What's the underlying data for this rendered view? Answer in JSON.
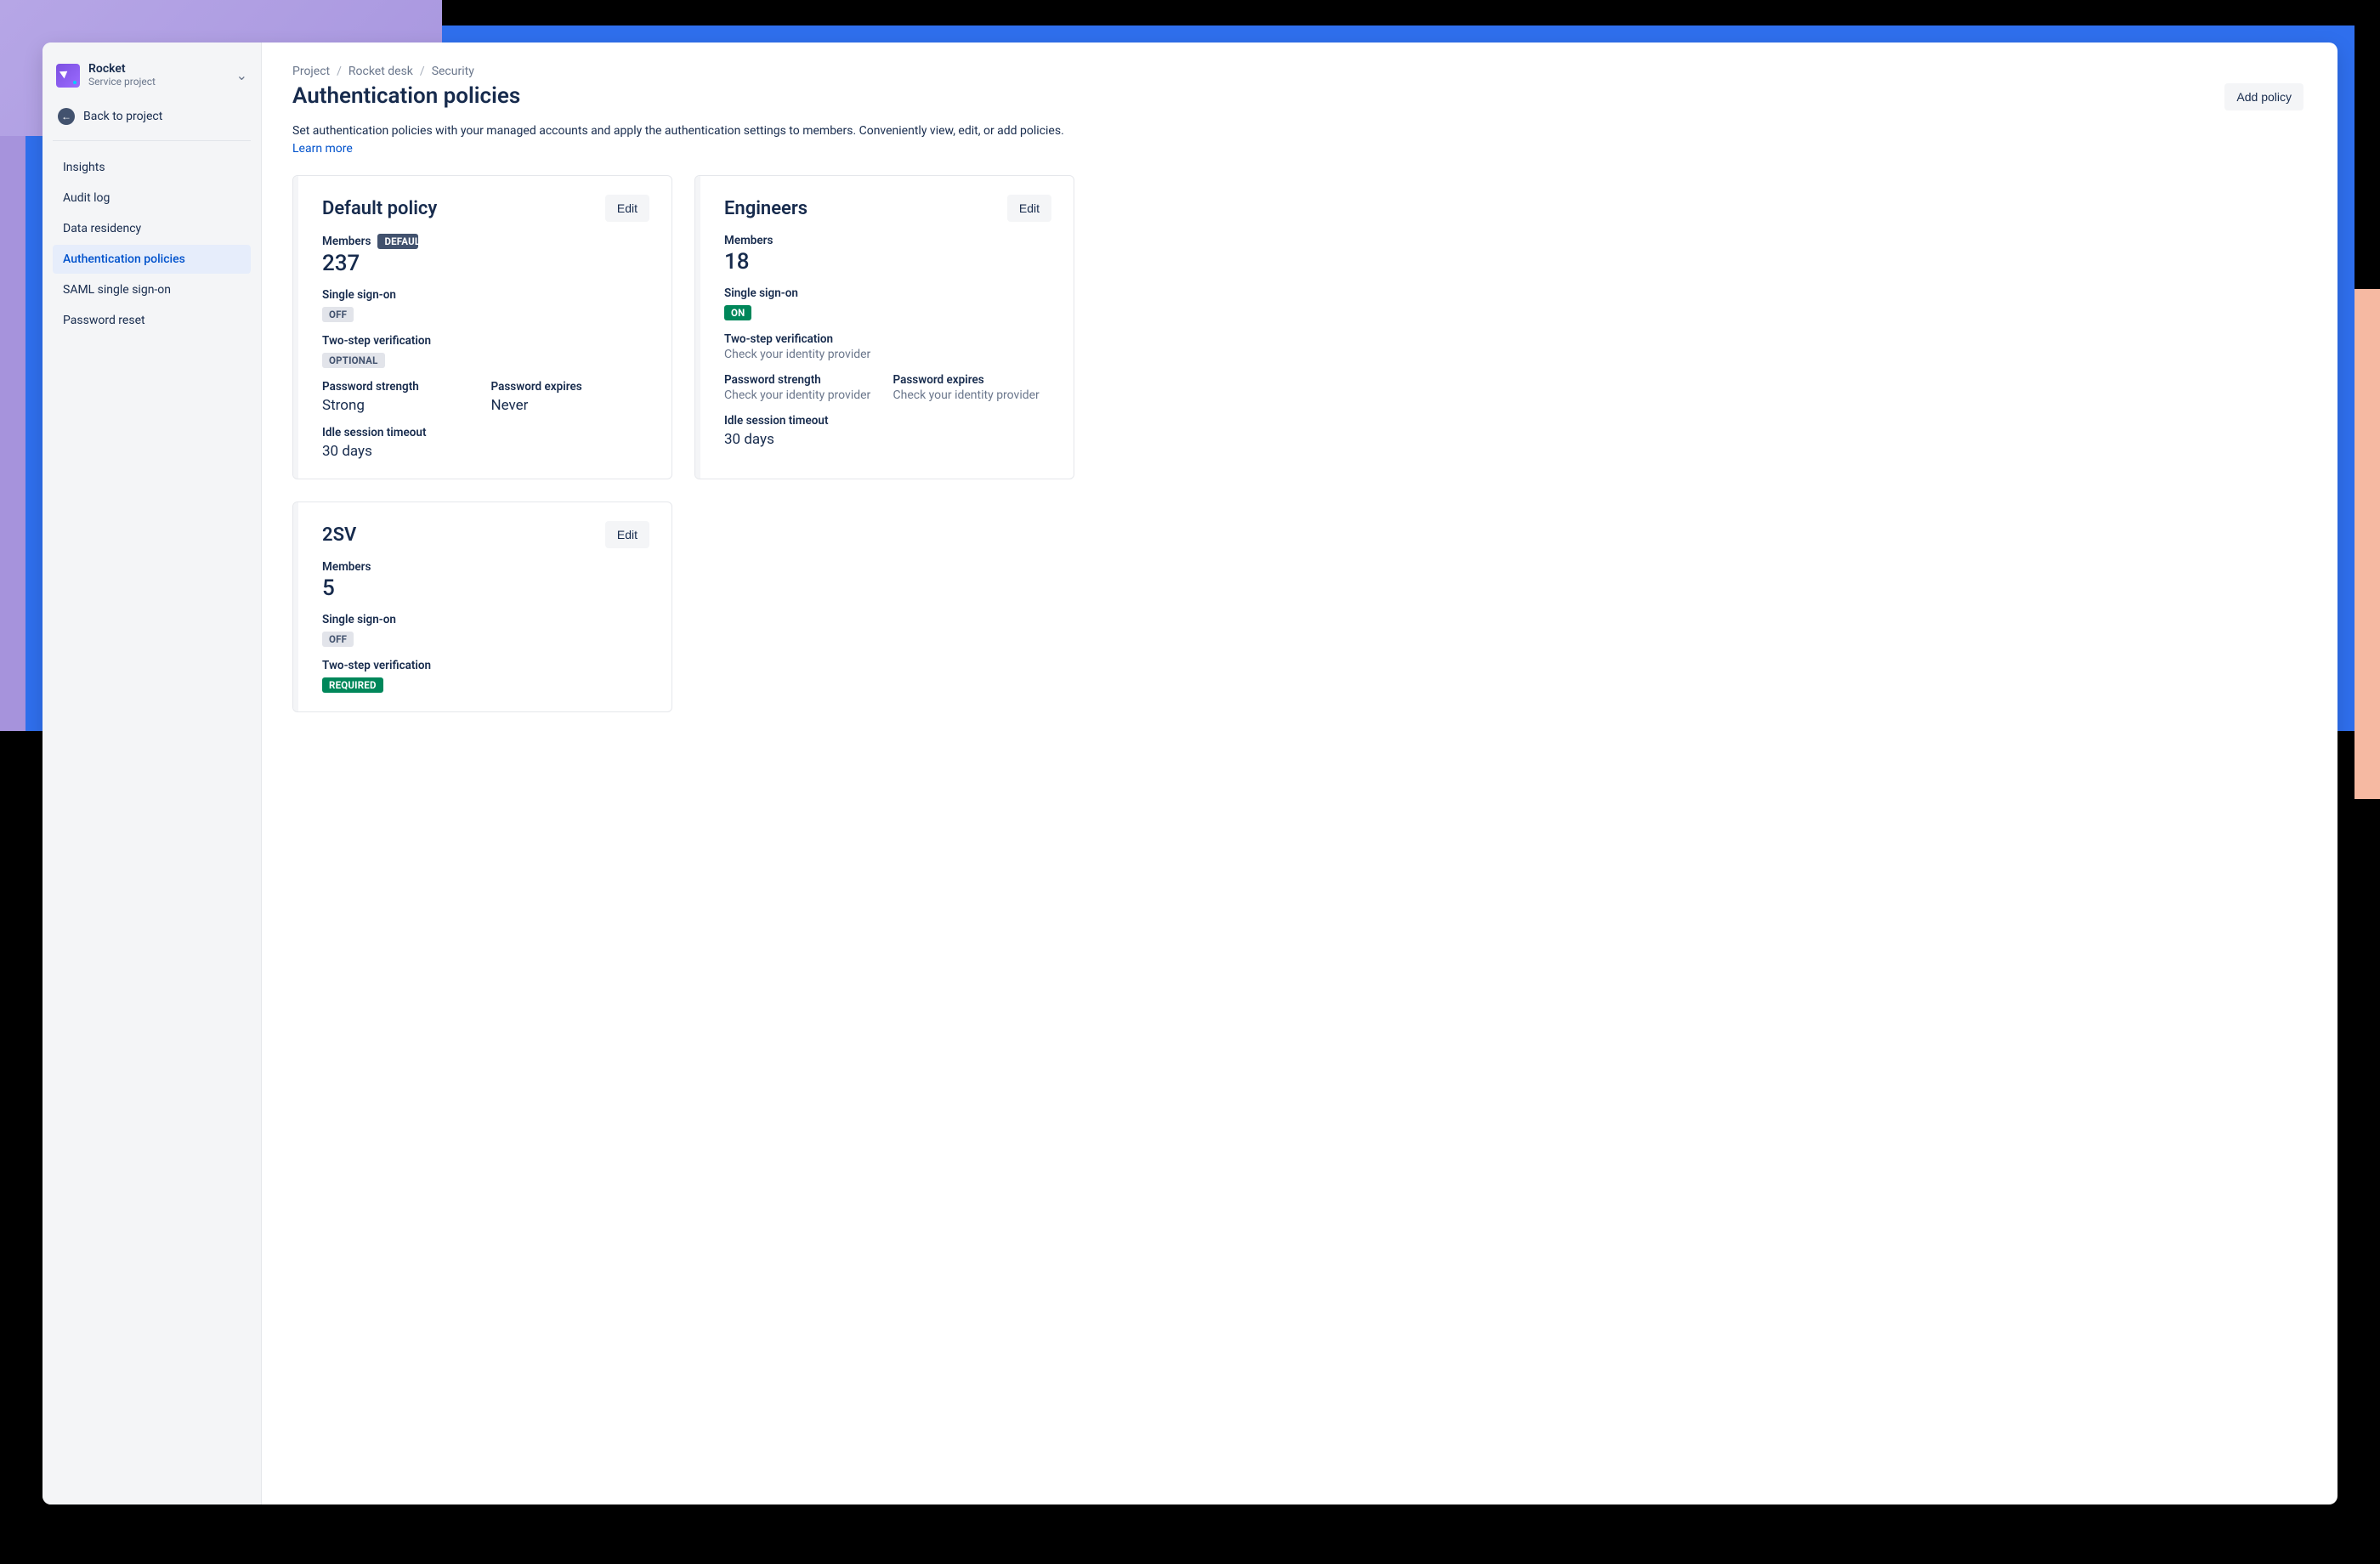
{
  "sidebar": {
    "project_name": "Rocket",
    "project_type": "Service project",
    "back_label": "Back to project",
    "items": [
      {
        "label": "Insights"
      },
      {
        "label": "Audit log"
      },
      {
        "label": "Data residency"
      },
      {
        "label": "Authentication policies",
        "active": true
      },
      {
        "label": "SAML single sign-on"
      },
      {
        "label": "Password reset"
      }
    ]
  },
  "breadcrumbs": [
    "Project",
    "Rocket desk",
    "Security"
  ],
  "header": {
    "title": "Authentication policies",
    "add_button": "Add policy",
    "description": "Set authentication policies with your managed accounts and apply the authentication settings to members. Conveniently view, edit, or add policies. ",
    "learn_more": "Learn more"
  },
  "labels": {
    "members": "Members",
    "sso": "Single sign-on",
    "two_step": "Two-step verification",
    "pwd_strength": "Password strength",
    "pwd_expires": "Password expires",
    "idle_timeout": "Idle session timeout",
    "edit": "Edit",
    "default_badge": "DEFAULT",
    "off": "OFF",
    "on": "ON",
    "optional": "OPTIONAL",
    "required": "REQUIRED",
    "check_idp": "Check your identity provider"
  },
  "policies": [
    {
      "name": "Default policy",
      "is_default": true,
      "members": "237",
      "sso_state": "OFF",
      "sso_style": "neutral",
      "two_step_state": "OPTIONAL",
      "two_step_style": "neutral",
      "pwd_strength": "Strong",
      "pwd_expires": "Never",
      "idle_timeout": "30 days"
    },
    {
      "name": "Engineers",
      "is_default": false,
      "members": "18",
      "sso_state": "ON",
      "sso_style": "green",
      "two_step_text": "Check your identity provider",
      "pwd_strength_text": "Check your identity provider",
      "pwd_expires_text": "Check your identity provider",
      "idle_timeout": "30 days"
    },
    {
      "name": "2SV",
      "is_default": false,
      "members": "5",
      "sso_state": "OFF",
      "sso_style": "neutral",
      "two_step_state": "REQUIRED",
      "two_step_style": "green"
    }
  ]
}
